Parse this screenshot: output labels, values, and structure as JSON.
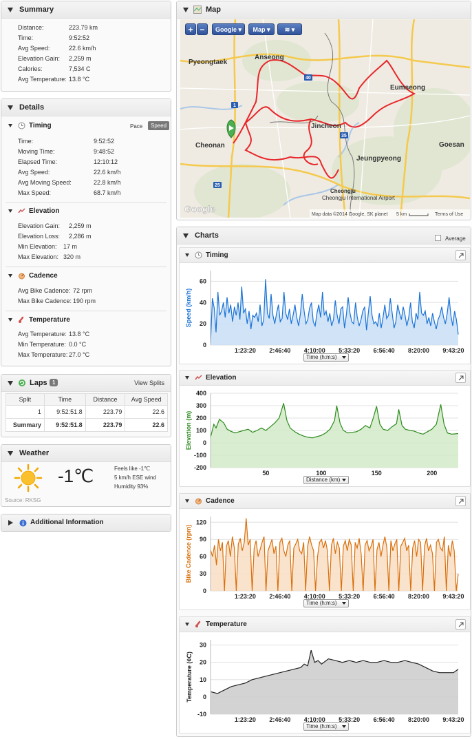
{
  "summary": {
    "title": "Summary",
    "rows": [
      {
        "label": "Distance:",
        "value": "223.79 km"
      },
      {
        "label": "Time:",
        "value": "9:52:52"
      },
      {
        "label": "Avg Speed:",
        "value": "22.6 km/h"
      },
      {
        "label": "Elevation Gain:",
        "value": "2,259 m"
      },
      {
        "label": "Calories:",
        "value": "7,534 C"
      },
      {
        "label": "Avg Temperature:",
        "value": "13.8 °C"
      }
    ]
  },
  "details": {
    "title": "Details",
    "timing": {
      "title": "Timing",
      "toggle_pace": "Pace",
      "toggle_speed": "Speed",
      "rows": [
        {
          "label": "Time:",
          "value": "9:52:52"
        },
        {
          "label": "Moving Time:",
          "value": "9:48:52"
        },
        {
          "label": "Elapsed Time:",
          "value": "12:10:12"
        },
        {
          "label": "Avg Speed:",
          "value": "22.6 km/h"
        },
        {
          "label": "Avg Moving Speed:",
          "value": "22.8 km/h"
        },
        {
          "label": "Max Speed:",
          "value": "68.7 km/h"
        }
      ]
    },
    "elevation": {
      "title": "Elevation",
      "rows": [
        {
          "label": "Elevation Gain:",
          "value": "2,259 m"
        },
        {
          "label": "Elevation Loss:",
          "value": "2,286 m"
        },
        {
          "label": "Min Elevation:",
          "value": "17 m"
        },
        {
          "label": "Max Elevation:",
          "value": "320 m"
        }
      ]
    },
    "cadence": {
      "title": "Cadence",
      "rows": [
        {
          "label": "Avg Bike Cadence:",
          "value": "72 rpm"
        },
        {
          "label": "Max Bike Cadence:",
          "value": "190 rpm"
        }
      ]
    },
    "temperature": {
      "title": "Temperature",
      "rows": [
        {
          "label": "Avg Temperature:",
          "value": "13.8 °C"
        },
        {
          "label": "Min Temperature:",
          "value": "0.0 °C"
        },
        {
          "label": "Max Temperature:",
          "value": "27.0 °C"
        }
      ]
    }
  },
  "laps": {
    "title": "Laps",
    "count": "1",
    "view_splits": "View Splits",
    "headers": [
      "Split",
      "Time",
      "Distance",
      "Avg Speed"
    ],
    "rows": [
      [
        "1",
        "9:52:51.8",
        "223.79",
        "22.6"
      ],
      [
        "Summary",
        "9:52:51.8",
        "223.79",
        "22.6"
      ]
    ]
  },
  "weather": {
    "title": "Weather",
    "temp": "-1℃",
    "feels_like": "Feels like -1℃",
    "wind": "5 km/h ESE wind",
    "humidity": "Humidity 93%",
    "source": "Source: RKSG"
  },
  "additional": {
    "title": "Additional Information"
  },
  "map": {
    "title": "Map",
    "btn_plus": "+",
    "btn_minus": "−",
    "provider": "Google",
    "maptype": "Map",
    "labels": [
      "Pyeongtaek",
      "Anseong",
      "Eumseong",
      "Jincheon",
      "Cheonan",
      "Jeungpyeong",
      "Goesan",
      "Cheongju International Airport",
      "Cheongju"
    ],
    "attribution": "Map data ©2014 Google, SK planet",
    "scale": "5 km",
    "terms": "Terms of Use",
    "watermark": "Google"
  },
  "charts": {
    "title": "Charts",
    "average_label": "Average",
    "timing": {
      "title": "Timing",
      "xselect": "Time (h:m:s)"
    },
    "elevation": {
      "title": "Elevation",
      "xselect": "Distance (km)"
    },
    "cadence": {
      "title": "Cadence",
      "xselect": "Time (h:m:s)"
    },
    "temperature": {
      "title": "Temperature",
      "xselect": "Time (h:m:s)"
    }
  },
  "colors": {
    "speed": "#1a73d6",
    "elevation": "#2e8b1e",
    "cadence": "#d9700c",
    "temperature": "#222222",
    "route": "#e8262b"
  },
  "chart_data": [
    {
      "type": "area",
      "ylabel": "Speed (km/h)",
      "xlabel": "Time (h:m:s)",
      "xticks": [
        "1:23:20",
        "2:46:40",
        "4:10:00",
        "5:33:20",
        "6:56:40",
        "8:20:00",
        "9:43:20"
      ],
      "yticks": [
        0,
        20,
        40,
        60
      ],
      "ylim": [
        0,
        70
      ],
      "xlim_seconds": [
        0,
        35700
      ],
      "series": [
        {
          "values": [
            2,
            44,
            35,
            12,
            50,
            28,
            32,
            40,
            26,
            45,
            30,
            38,
            22,
            36,
            28,
            40,
            24,
            55,
            30,
            34,
            20,
            32,
            15,
            28,
            26,
            30,
            22,
            38,
            18,
            24,
            62,
            30,
            25,
            48,
            28,
            20,
            30,
            38,
            22,
            25,
            50,
            30,
            24,
            34,
            20,
            28,
            38,
            26,
            18,
            30,
            48,
            32,
            20,
            24,
            35,
            40,
            22,
            18,
            30,
            38,
            26,
            50,
            28,
            32,
            22,
            30,
            18,
            24,
            42,
            28,
            20,
            34,
            36,
            16,
            28,
            45,
            30,
            22,
            20,
            40,
            26,
            18,
            24,
            32,
            36,
            14,
            30,
            46,
            28,
            20,
            22,
            18,
            30,
            16,
            26,
            38,
            25,
            28,
            44,
            30,
            16,
            22,
            38,
            30,
            24,
            36,
            28,
            18,
            26,
            40,
            22,
            16,
            30,
            24,
            50,
            30,
            28,
            32,
            20,
            26,
            18,
            30,
            22,
            15,
            24,
            28,
            36,
            26,
            20,
            30,
            45,
            28,
            18,
            32,
            24,
            10
          ]
        }
      ]
    },
    {
      "type": "area",
      "ylabel": "Elevation (m)",
      "xlabel": "Distance (km)",
      "xticks": [
        50,
        100,
        150,
        200
      ],
      "yticks": [
        -200,
        -100,
        0,
        100,
        200,
        300,
        400
      ],
      "ylim": [
        -200,
        400
      ],
      "xlim": [
        0,
        223.79
      ],
      "series": [
        {
          "points": [
            [
              0,
              45
            ],
            [
              3,
              150
            ],
            [
              5,
              120
            ],
            [
              8,
              190
            ],
            [
              12,
              160
            ],
            [
              15,
              110
            ],
            [
              18,
              95
            ],
            [
              22,
              80
            ],
            [
              26,
              90
            ],
            [
              30,
              100
            ],
            [
              34,
              110
            ],
            [
              38,
              85
            ],
            [
              42,
              100
            ],
            [
              46,
              120
            ],
            [
              50,
              100
            ],
            [
              54,
              130
            ],
            [
              58,
              160
            ],
            [
              62,
              200
            ],
            [
              66,
              320
            ],
            [
              69,
              180
            ],
            [
              72,
              120
            ],
            [
              76,
              90
            ],
            [
              80,
              70
            ],
            [
              84,
              55
            ],
            [
              88,
              45
            ],
            [
              92,
              40
            ],
            [
              96,
              50
            ],
            [
              100,
              60
            ],
            [
              104,
              80
            ],
            [
              108,
              110
            ],
            [
              112,
              180
            ],
            [
              114,
              300
            ],
            [
              117,
              160
            ],
            [
              120,
              100
            ],
            [
              124,
              80
            ],
            [
              128,
              85
            ],
            [
              132,
              90
            ],
            [
              136,
              110
            ],
            [
              140,
              140
            ],
            [
              144,
              120
            ],
            [
              147,
              200
            ],
            [
              150,
              295
            ],
            [
              153,
              150
            ],
            [
              156,
              110
            ],
            [
              160,
              100
            ],
            [
              164,
              130
            ],
            [
              168,
              155
            ],
            [
              170,
              270
            ],
            [
              173,
              140
            ],
            [
              176,
              110
            ],
            [
              180,
              100
            ],
            [
              184,
              95
            ],
            [
              188,
              80
            ],
            [
              192,
              70
            ],
            [
              196,
              90
            ],
            [
              200,
              110
            ],
            [
              204,
              150
            ],
            [
              208,
              310
            ],
            [
              211,
              150
            ],
            [
              214,
              80
            ],
            [
              218,
              70
            ],
            [
              223.79,
              75
            ]
          ]
        }
      ]
    },
    {
      "type": "area",
      "ylabel": "Bike Cadence (rpm)",
      "xlabel": "Time (h:m:s)",
      "xticks": [
        "1:23:20",
        "2:46:40",
        "4:10:00",
        "5:33:20",
        "6:56:40",
        "8:20:00",
        "9:43:20"
      ],
      "yticks": [
        0,
        30,
        60,
        90,
        120
      ],
      "ylim": [
        0,
        130
      ],
      "xlim_seconds": [
        0,
        35700
      ],
      "series": [
        {
          "values": [
            72,
            60,
            80,
            45,
            90,
            70,
            85,
            0,
            78,
            88,
            60,
            95,
            75,
            0,
            82,
            92,
            70,
            85,
            127,
            80,
            90,
            0,
            75,
            88,
            60,
            72,
            85,
            95,
            0,
            70,
            80,
            90,
            65,
            78,
            0,
            85,
            92,
            70,
            60,
            80,
            88,
            0,
            75,
            82,
            90,
            70,
            65,
            85,
            0,
            78,
            95,
            80,
            70,
            0,
            60,
            85,
            90,
            75,
            88,
            70,
            0,
            80,
            92,
            65,
            85,
            75,
            0,
            78,
            88,
            70,
            90,
            80,
            0,
            85,
            75,
            92,
            65,
            0,
            80,
            88,
            70,
            78,
            90,
            0,
            72,
            85,
            60,
            80,
            95,
            75,
            0,
            88,
            70,
            82,
            90,
            0,
            78,
            85,
            92,
            70,
            80,
            0,
            75,
            88,
            60,
            90,
            85,
            0,
            78,
            92,
            70,
            80,
            65,
            0,
            85,
            90,
            75,
            70,
            95,
            0,
            80,
            60,
            88,
            70,
            0,
            30
          ]
        }
      ]
    },
    {
      "type": "area",
      "ylabel": "Temperature (¢C)",
      "xlabel": "Time (h:m:s)",
      "xticks": [
        "1:23:20",
        "2:46:40",
        "4:10:00",
        "5:33:20",
        "6:56:40",
        "8:20:00",
        "9:43:20"
      ],
      "yticks": [
        -10,
        0,
        10,
        20,
        30
      ],
      "ylim": [
        -10,
        33
      ],
      "xlim_seconds": [
        0,
        35700
      ],
      "series": [
        {
          "points": [
            [
              0,
              3
            ],
            [
              1000,
              2
            ],
            [
              2000,
              4
            ],
            [
              3000,
              6
            ],
            [
              4000,
              7
            ],
            [
              5000,
              8
            ],
            [
              6000,
              10
            ],
            [
              7000,
              11
            ],
            [
              8000,
              12
            ],
            [
              9000,
              13
            ],
            [
              10000,
              14
            ],
            [
              11000,
              15
            ],
            [
              12000,
              16
            ],
            [
              13000,
              17
            ],
            [
              13500,
              19
            ],
            [
              14000,
              18
            ],
            [
              14500,
              27
            ],
            [
              15000,
              20
            ],
            [
              15500,
              21
            ],
            [
              16000,
              19
            ],
            [
              17000,
              22
            ],
            [
              18000,
              21
            ],
            [
              19000,
              20
            ],
            [
              20000,
              21
            ],
            [
              21000,
              20
            ],
            [
              22000,
              21
            ],
            [
              23000,
              20
            ],
            [
              24000,
              20
            ],
            [
              25000,
              21
            ],
            [
              26000,
              20
            ],
            [
              27000,
              20
            ],
            [
              28000,
              21
            ],
            [
              29000,
              20
            ],
            [
              30000,
              19
            ],
            [
              31000,
              17
            ],
            [
              32000,
              15
            ],
            [
              33000,
              14
            ],
            [
              34000,
              14
            ],
            [
              35000,
              14
            ],
            [
              35700,
              16
            ]
          ]
        }
      ]
    }
  ]
}
